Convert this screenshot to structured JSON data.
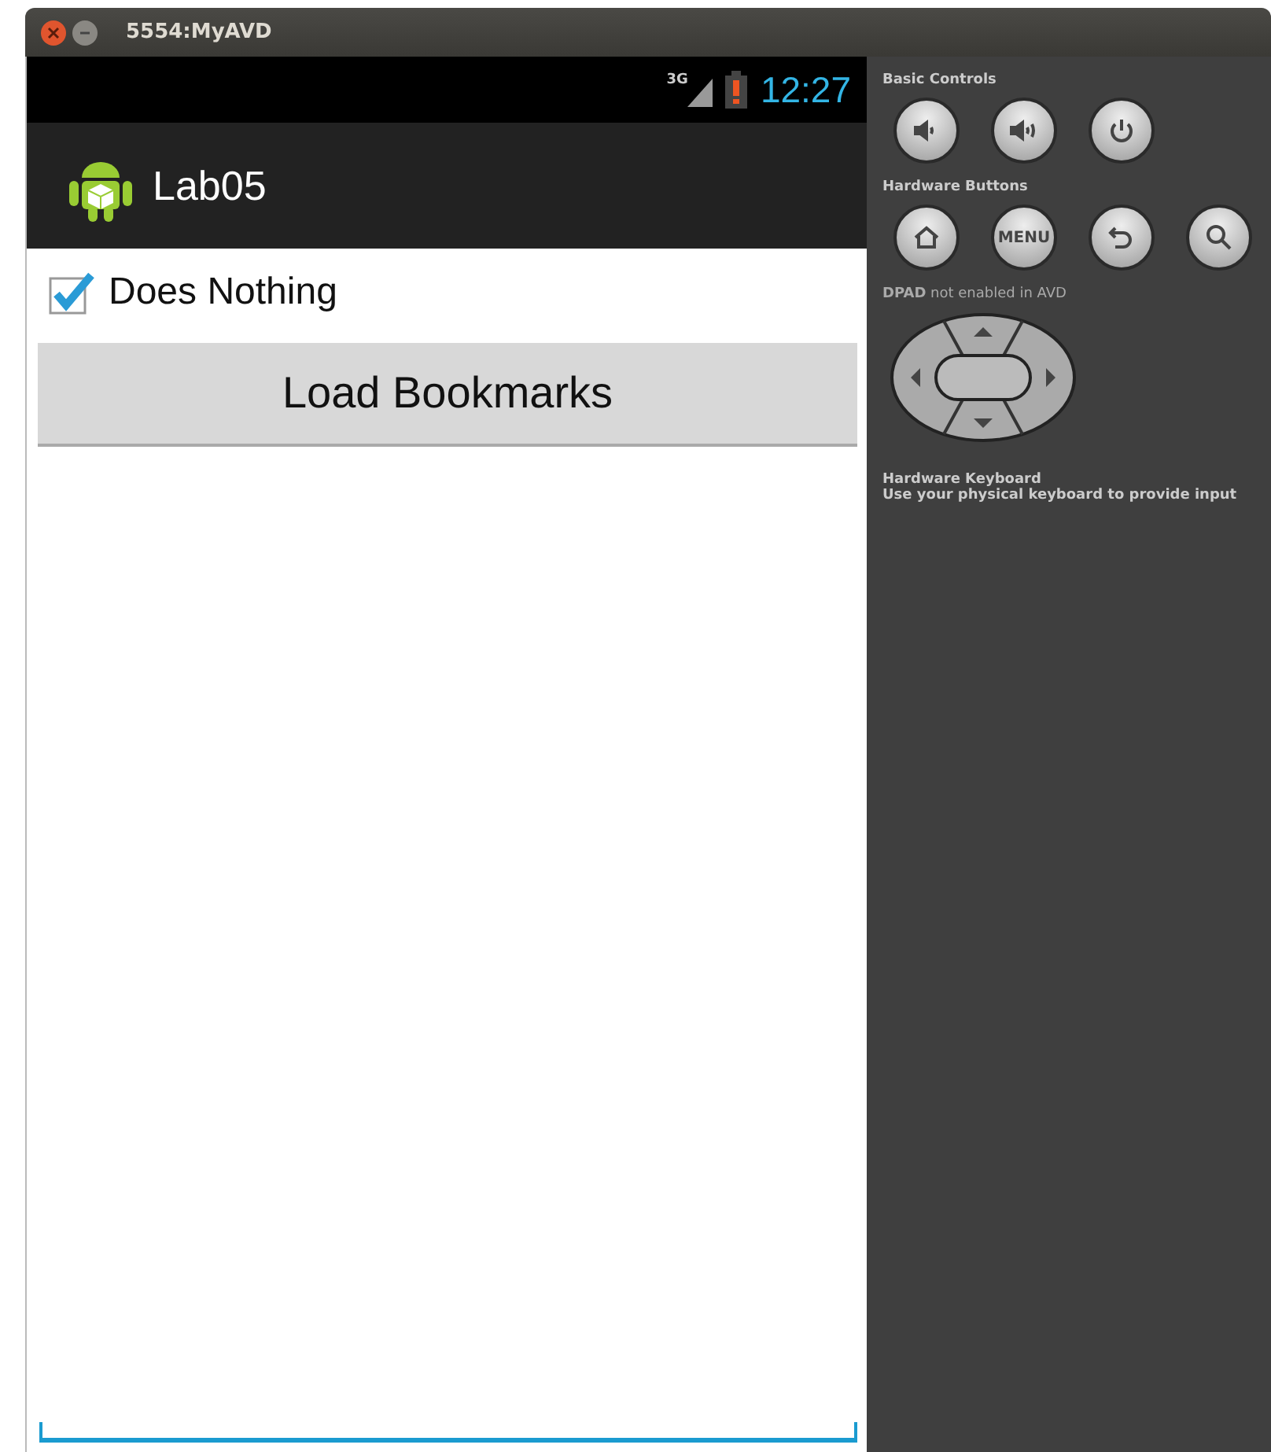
{
  "window": {
    "title": "5554:MyAVD"
  },
  "status_bar": {
    "network": "3G",
    "time": "12:27"
  },
  "action_bar": {
    "title": "Lab05"
  },
  "checkbox": {
    "label": "Does Nothing",
    "checked": true
  },
  "button": {
    "label": "Load Bookmarks"
  },
  "controls": {
    "basic_title": "Basic Controls",
    "basic": [
      {
        "kind": "volume-down"
      },
      {
        "kind": "volume-up"
      },
      {
        "kind": "power"
      }
    ],
    "hardware_title": "Hardware Buttons",
    "hardware": [
      {
        "kind": "home"
      },
      {
        "kind": "menu",
        "label": "MENU"
      },
      {
        "kind": "back"
      },
      {
        "kind": "search"
      }
    ],
    "dpad_note": "**DPAD** not enabled in AVD",
    "keyboard_title": "Hardware Keyboard",
    "keyboard_note": "Use your physical keyboard to provide input"
  }
}
